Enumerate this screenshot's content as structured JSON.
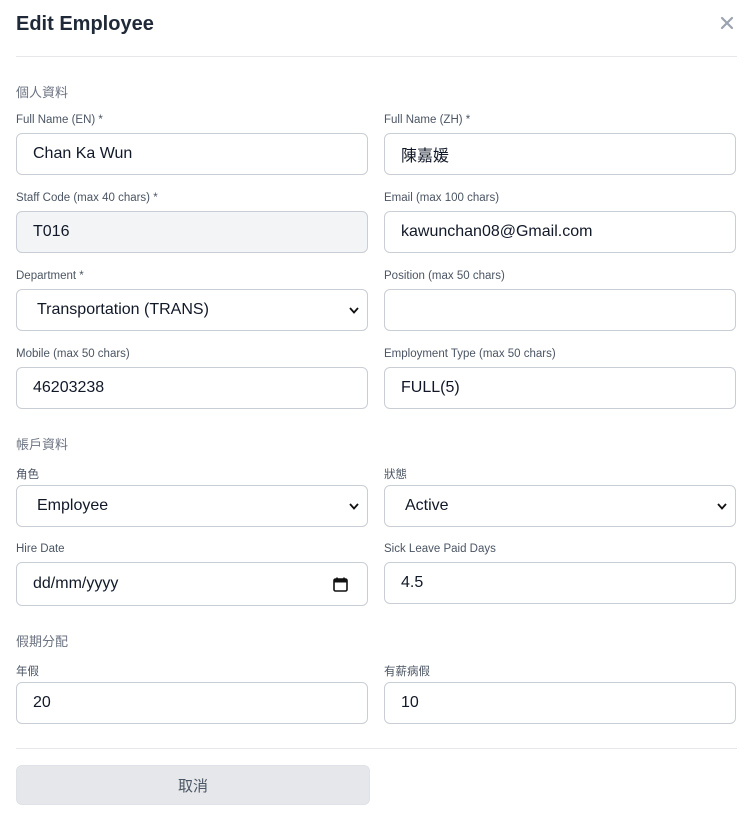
{
  "dialog": {
    "title": "Edit Employee",
    "close_symbol": "×"
  },
  "sections": {
    "personal": "個人資料",
    "account": "帳戶資料",
    "leave": "假期分配"
  },
  "fields": {
    "full_name_en": {
      "label": "Full Name (EN) *",
      "value": "Chan Ka Wun"
    },
    "full_name_zh": {
      "label": "Full Name (ZH) *",
      "value": "陳嘉媛"
    },
    "staff_code": {
      "label": "Staff Code (max 40 chars) *",
      "value": "T016"
    },
    "email": {
      "label": "Email (max 100 chars)",
      "value": "kawunchan08@Gmail.com"
    },
    "department": {
      "label": "Department *",
      "value": "Transportation (TRANS)"
    },
    "position": {
      "label": "Position (max 50 chars)",
      "value": ""
    },
    "mobile": {
      "label": "Mobile (max 50 chars)",
      "value": "46203238"
    },
    "employment_type": {
      "label": "Employment Type (max 50 chars)",
      "value": "FULL(5)"
    },
    "role": {
      "label": "角色",
      "value": "Employee"
    },
    "status": {
      "label": "狀態",
      "value": "Active"
    },
    "hire_date": {
      "label": "Hire Date",
      "placeholder": "dd/mm/yyyy"
    },
    "sick_leave_paid_days": {
      "label": "Sick Leave Paid Days",
      "value": "4.5"
    },
    "annual_leave": {
      "label": "年假",
      "value": "20"
    },
    "paid_sick_leave": {
      "label": "有薪病假",
      "value": "10"
    }
  },
  "footer": {
    "cancel_label": "取消"
  },
  "icons": {
    "close": "close-icon",
    "select_arrow": "chevron-down-icon",
    "date_picker": "calendar-icon"
  },
  "colors": {
    "border": "#c9ced6",
    "readonly_bg": "#f3f4f6",
    "cancel_bg": "#e5e7eb"
  }
}
